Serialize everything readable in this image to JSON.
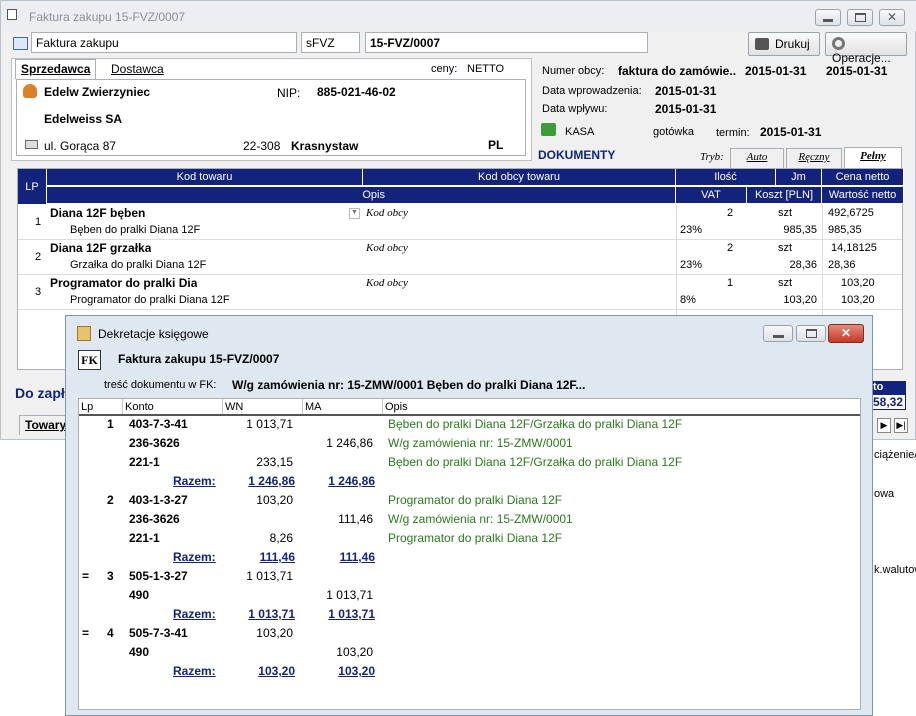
{
  "window": {
    "title": "Faktura zakupu 15-FVZ/0007"
  },
  "toolbar": {
    "doc_type": "Faktura zakupu",
    "series": "sFVZ",
    "number": "15-FVZ/0007",
    "print_label": "Drukuj",
    "operations_label": "Operacje..."
  },
  "party": {
    "tab_seller": "Sprzedawca",
    "tab_supplier": "Dostawca",
    "prices_label": "ceny:",
    "prices_value": "NETTO",
    "name": "Edelw Zwierzyniec",
    "nip_label": "NIP:",
    "nip": "885-021-46-02",
    "full_name": "Edelweiss SA",
    "street": "ul. Gorąca 87",
    "postcode": "22-308",
    "city": "Krasnystaw",
    "country": "PL"
  },
  "docinfo": {
    "foreign_no_label": "Numer obcy:",
    "foreign_no": "faktura do zamówie..",
    "date1": "2015-01-31",
    "date2": "2015-01-31",
    "entry_label": "Data wprowadzenia:",
    "entry_date": "2015-01-31",
    "received_label": "Data wpływu:",
    "received_date": "2015-01-31",
    "cash_label": "KASA",
    "payment": "gotówka",
    "due_label": "termin:",
    "due_date": "2015-01-31"
  },
  "documents": {
    "label": "DOKUMENTY",
    "mode_label": "Tryb:",
    "tabs": [
      "Auto",
      "Ręczny",
      "Pełny"
    ]
  },
  "grid": {
    "headers": {
      "lp": "LP",
      "kod": "Kod towaru",
      "kod_obcy": "Kod obcy towaru",
      "ilosc": "Ilość",
      "jm": "Jm",
      "cena": "Cena netto",
      "opis": "Opis",
      "vat": "VAT",
      "koszt": "Koszt [PLN]",
      "wartosc": "Wartość netto"
    },
    "rows": [
      {
        "lp": "1",
        "name": "Diana 12F bęben",
        "obcy": "Kod obcy",
        "qty": "2",
        "unit": "szt",
        "price": "492,6725",
        "desc": "Bęben do pralki Diana 12F",
        "vat": "23%",
        "cost": "985,35",
        "value": "985,35"
      },
      {
        "lp": "2",
        "name": "Diana 12F grzałka",
        "obcy": "Kod obcy",
        "qty": "2",
        "unit": "szt",
        "price": "14,18125",
        "desc": "Grzałka do pralki Diana 12F",
        "vat": "23%",
        "cost": "28,36",
        "value": "28,36"
      },
      {
        "lp": "3",
        "name": "Programator do pralki Dia",
        "obcy": "Kod obcy",
        "qty": "1",
        "unit": "szt",
        "price": "103,20",
        "desc": "Programator do pralki Diana 12F",
        "vat": "8%",
        "cost": "103,20",
        "value": "103,20"
      }
    ]
  },
  "bottom": {
    "pay_label": "Do zapł",
    "tab_goods": "Towary",
    "total_label": "to",
    "total": "58,32",
    "side1": "ciążenie/6",
    "side2": "owa",
    "side3": "k.walutow"
  },
  "dialog": {
    "title": "Dekretacje księgowe",
    "fk": "FK",
    "doc": "Faktura zakupu 15-FVZ/0007",
    "content_label": "treść dokumentu w FK:",
    "content": "W/g zamówienia nr: 15-ZMW/0001 Bęben do pralki Diana 12F...",
    "headers": {
      "lp": "Lp",
      "konto": "Konto",
      "wn": "WN",
      "ma": "MA",
      "opis": "Opis"
    },
    "razem_label": "Razem:",
    "rows": [
      {
        "marker": "",
        "lp": "1",
        "konto": "403-7-3-41",
        "wn": "1 013,71",
        "ma": "",
        "opis": "Bęben do pralki Diana 12F/Grzałka do pralki Diana 12F"
      },
      {
        "marker": "",
        "lp": "",
        "konto": "236-3626",
        "wn": "",
        "ma": "1 246,86",
        "opis": "W/g zamówienia nr: 15-ZMW/0001"
      },
      {
        "marker": "",
        "lp": "",
        "konto": "221-1",
        "wn": "233,15",
        "ma": "",
        "opis": "Bęben do pralki Diana 12F/Grzałka do pralki Diana 12F"
      },
      {
        "razem": true,
        "wn": "1 246,86",
        "ma": "1 246,86"
      },
      {
        "marker": "",
        "lp": "2",
        "konto": "403-1-3-27",
        "wn": "103,20",
        "ma": "",
        "opis": "Programator do pralki Diana 12F"
      },
      {
        "marker": "",
        "lp": "",
        "konto": "236-3626",
        "wn": "",
        "ma": "111,46",
        "opis": "W/g zamówienia nr: 15-ZMW/0001"
      },
      {
        "marker": "",
        "lp": "",
        "konto": "221-1",
        "wn": "8,26",
        "ma": "",
        "opis": "Programator do pralki Diana 12F"
      },
      {
        "razem": true,
        "wn": "111,46",
        "ma": "111,46"
      },
      {
        "marker": "=",
        "lp": "3",
        "konto": "505-1-3-27",
        "wn": "1 013,71",
        "ma": "",
        "opis": ""
      },
      {
        "marker": "",
        "lp": "",
        "konto": "490",
        "wn": "",
        "ma": "1 013,71",
        "opis": ""
      },
      {
        "razem": true,
        "wn": "1 013,71",
        "ma": "1 013,71"
      },
      {
        "marker": "=",
        "lp": "4",
        "konto": "505-7-3-41",
        "wn": "103,20",
        "ma": "",
        "opis": ""
      },
      {
        "marker": "",
        "lp": "",
        "konto": "490",
        "wn": "",
        "ma": "103,20",
        "opis": ""
      },
      {
        "razem": true,
        "wn": "103,20",
        "ma": "103,20"
      }
    ]
  }
}
